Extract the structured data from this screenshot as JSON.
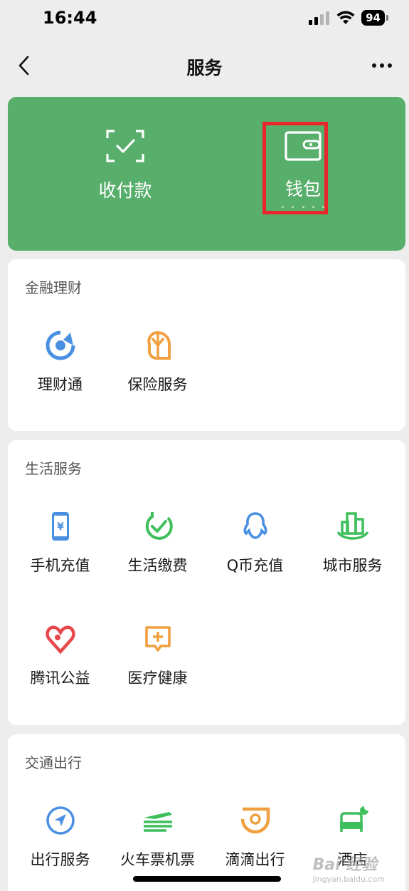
{
  "status": {
    "time": "16:44",
    "battery": "94"
  },
  "nav": {
    "title": "服务"
  },
  "top_card": {
    "pay_label": "收付款",
    "wallet_label": "钱包"
  },
  "finance": {
    "title": "金融理财",
    "items": [
      {
        "label": "理财通",
        "icon": "licaitong-icon"
      },
      {
        "label": "保险服务",
        "icon": "insurance-icon"
      }
    ]
  },
  "life": {
    "title": "生活服务",
    "items": [
      {
        "label": "手机充值",
        "icon": "phone-recharge-icon"
      },
      {
        "label": "生活缴费",
        "icon": "utility-payment-icon"
      },
      {
        "label": "Q币充值",
        "icon": "qq-coin-icon"
      },
      {
        "label": "城市服务",
        "icon": "city-service-icon"
      },
      {
        "label": "腾讯公益",
        "icon": "charity-icon"
      },
      {
        "label": "医疗健康",
        "icon": "medical-icon"
      }
    ]
  },
  "transport": {
    "title": "交通出行",
    "items": [
      {
        "label": "出行服务",
        "icon": "travel-icon"
      },
      {
        "label": "火车票机票",
        "icon": "train-ticket-icon"
      },
      {
        "label": "滴滴出行",
        "icon": "didi-icon"
      },
      {
        "label": "酒店",
        "icon": "hotel-icon"
      }
    ]
  },
  "watermark": {
    "text": "Bai 经验",
    "sub": "jingyan.baidu.com"
  },
  "colors": {
    "green": "#58ae6b",
    "highlight": "#e8262b",
    "blue": "#4a90e2",
    "orange": "#f0a040",
    "green_icon": "#3ebf5c",
    "red": "#e8474a"
  }
}
